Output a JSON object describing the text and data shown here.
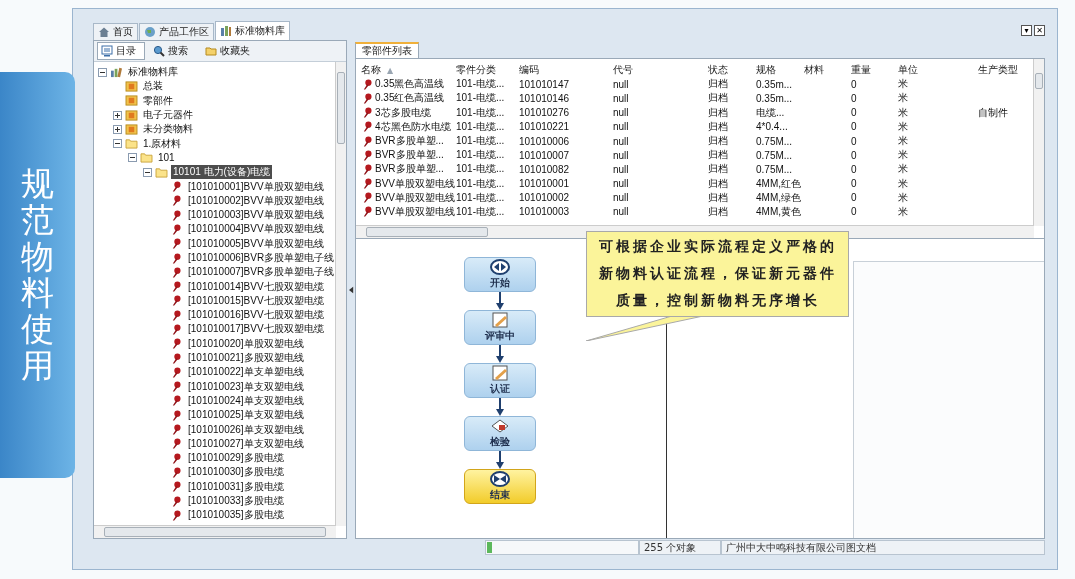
{
  "side_label": "规范物料使用",
  "window_tabs": [
    {
      "label": "首页",
      "kind": "home",
      "selected": false
    },
    {
      "label": "产品工作区",
      "kind": "workspace",
      "selected": false
    },
    {
      "label": "标准物料库",
      "kind": "library",
      "selected": true
    }
  ],
  "window_buttons": [
    "▾",
    "✕"
  ],
  "left_toolbar": [
    {
      "label": "目录",
      "kind": "catalog",
      "selected": true
    },
    {
      "label": "搜索",
      "kind": "search",
      "selected": false
    },
    {
      "label": "收藏夹",
      "kind": "favorites",
      "selected": false
    }
  ],
  "tree": [
    {
      "kind": "library",
      "label": "标准物料库",
      "expanded": true,
      "selected": false,
      "children": [
        {
          "kind": "category",
          "label": "总装",
          "selected": false
        },
        {
          "kind": "category",
          "label": "零部件",
          "selected": false
        },
        {
          "kind": "category",
          "label": "电子元器件",
          "expanded": false,
          "selected": false
        },
        {
          "kind": "category",
          "label": "未分类物料",
          "expanded": false,
          "selected": false
        },
        {
          "kind": "folder",
          "label": "1.原材料",
          "expanded": true,
          "selected": false,
          "children": [
            {
              "kind": "folder",
              "label": "101",
              "expanded": true,
              "selected": false,
              "children": [
                {
                  "kind": "folder",
                  "label": "10101 电力(设备)电缆",
                  "expanded": true,
                  "selected": true,
                  "children": [
                    {
                      "kind": "part",
                      "label": "[101010001]BVV单股双塑电线",
                      "selected": false
                    },
                    {
                      "kind": "part",
                      "label": "[101010002]BVV单股双塑电线",
                      "selected": false
                    },
                    {
                      "kind": "part",
                      "label": "[101010003]BVV单股双塑电线",
                      "selected": false
                    },
                    {
                      "kind": "part",
                      "label": "[101010004]BVV单股双塑电线",
                      "selected": false
                    },
                    {
                      "kind": "part",
                      "label": "[101010005]BVV单股双塑电线",
                      "selected": false
                    },
                    {
                      "kind": "part",
                      "label": "[101010006]BVR多股单塑电子线",
                      "selected": false
                    },
                    {
                      "kind": "part",
                      "label": "[101010007]BVR多股单塑电子线",
                      "selected": false
                    },
                    {
                      "kind": "part",
                      "label": "[101010014]BVV七股双塑电缆",
                      "selected": false
                    },
                    {
                      "kind": "part",
                      "label": "[101010015]BVV七股双塑电缆",
                      "selected": false
                    },
                    {
                      "kind": "part",
                      "label": "[101010016]BVV七股双塑电缆",
                      "selected": false
                    },
                    {
                      "kind": "part",
                      "label": "[101010017]BVV七股双塑电缆",
                      "selected": false
                    },
                    {
                      "kind": "part",
                      "label": "[101010020]单股双塑电线",
                      "selected": false
                    },
                    {
                      "kind": "part",
                      "label": "[101010021]多股双塑电线",
                      "selected": false
                    },
                    {
                      "kind": "part",
                      "label": "[101010022]单支单塑电线",
                      "selected": false
                    },
                    {
                      "kind": "part",
                      "label": "[101010023]单支双塑电线",
                      "selected": false
                    },
                    {
                      "kind": "part",
                      "label": "[101010024]单支双塑电线",
                      "selected": false
                    },
                    {
                      "kind": "part",
                      "label": "[101010025]单支双塑电线",
                      "selected": false
                    },
                    {
                      "kind": "part",
                      "label": "[101010026]单支双塑电线",
                      "selected": false
                    },
                    {
                      "kind": "part",
                      "label": "[101010027]单支双塑电线",
                      "selected": false
                    },
                    {
                      "kind": "part",
                      "label": "[101010029]多股电缆",
                      "selected": false
                    },
                    {
                      "kind": "part",
                      "label": "[101010030]多股电缆",
                      "selected": false
                    },
                    {
                      "kind": "part",
                      "label": "[101010031]多股电缆",
                      "selected": false
                    },
                    {
                      "kind": "part",
                      "label": "[101010033]多股电缆",
                      "selected": false
                    },
                    {
                      "kind": "part",
                      "label": "[101010035]多股电缆",
                      "selected": false
                    }
                  ]
                }
              ]
            }
          ]
        }
      ]
    }
  ],
  "list_tab": {
    "label": "零部件列表",
    "selected": true
  },
  "table": {
    "columns": [
      {
        "label": "名称",
        "sort_mark": "▲"
      },
      {
        "label": "零件分类"
      },
      {
        "label": "编码"
      },
      {
        "label": "代号"
      },
      {
        "label": "状态"
      },
      {
        "label": "规格"
      },
      {
        "label": "材料"
      },
      {
        "label": "重量"
      },
      {
        "label": "单位"
      },
      {
        "label": "生产类型"
      }
    ],
    "rows": [
      {
        "name": "0.35黑色高温线",
        "category": "101-电缆...",
        "code": "101010147",
        "designation": "null",
        "status": "归档",
        "spec": "0.35m...",
        "weight": "0",
        "unit": "米"
      },
      {
        "name": "0.35红色高温线",
        "category": "101-电缆...",
        "code": "101010146",
        "designation": "null",
        "status": "归档",
        "spec": "0.35m...",
        "weight": "0",
        "unit": "米"
      },
      {
        "name": "3芯多股电缆",
        "category": "101-电缆...",
        "code": "101010276",
        "designation": "null",
        "status": "归档",
        "spec": "电缆...",
        "weight": "0",
        "unit": "米",
        "production_type": "自制件"
      },
      {
        "name": "4芯黑色防水电缆",
        "category": "101-电缆...",
        "code": "101010221",
        "designation": "null",
        "status": "归档",
        "spec": "4*0.4...",
        "weight": "0",
        "unit": "米"
      },
      {
        "name": "BVR多股单塑...",
        "category": "101-电缆...",
        "code": "101010006",
        "designation": "null",
        "status": "归档",
        "spec": "0.75M...",
        "weight": "0",
        "unit": "米"
      },
      {
        "name": "BVR多股单塑...",
        "category": "101-电缆...",
        "code": "101010007",
        "designation": "null",
        "status": "归档",
        "spec": "0.75M...",
        "weight": "0",
        "unit": "米"
      },
      {
        "name": "BVR多股单塑...",
        "category": "101-电缆...",
        "code": "101010082",
        "designation": "null",
        "status": "归档",
        "spec": "0.75M...",
        "weight": "0",
        "unit": "米"
      },
      {
        "name": "BVV单股双塑电线",
        "category": "101-电缆...",
        "code": "101010001",
        "designation": "null",
        "status": "归档",
        "spec": "4MM,红色",
        "weight": "0",
        "unit": "米"
      },
      {
        "name": "BVV单股双塑电线",
        "category": "101-电缆...",
        "code": "101010002",
        "designation": "null",
        "status": "归档",
        "spec": "4MM,绿色",
        "weight": "0",
        "unit": "米"
      },
      {
        "name": "BVV单股双塑电线",
        "category": "101-电缆...",
        "code": "101010003",
        "designation": "null",
        "status": "归档",
        "spec": "4MM,黄色",
        "weight": "0",
        "unit": "米"
      }
    ]
  },
  "workflow": {
    "nodes": [
      {
        "kind": "start",
        "label": "开始"
      },
      {
        "kind": "task",
        "label": "评审中"
      },
      {
        "kind": "task",
        "label": "认证"
      },
      {
        "kind": "inspect",
        "label": "检验"
      },
      {
        "kind": "end",
        "label": "结束"
      }
    ]
  },
  "callout": "可根据企业实际流程定义严格的新物料认证流程，保证新元器件质量，控制新物料无序增长",
  "status_bar": {
    "progress": {
      "level": 0.03
    },
    "count": "255 个对象",
    "company": "广州中大中鸣科技有限公司图文档"
  }
}
